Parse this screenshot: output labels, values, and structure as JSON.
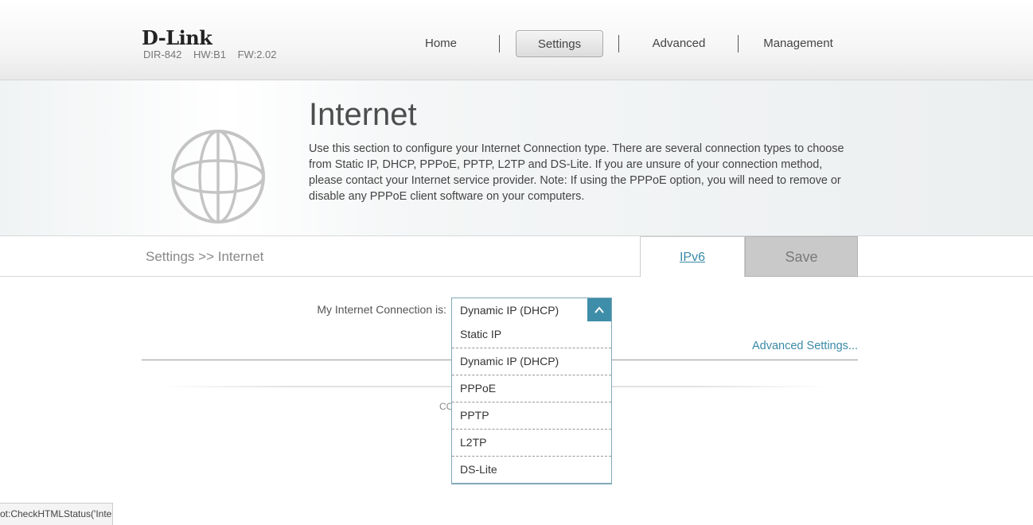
{
  "header": {
    "logo": "D-Link",
    "model": "DIR-842",
    "hw": "HW:B1",
    "fw": "FW:2.02"
  },
  "nav": {
    "items": [
      {
        "label": "Home",
        "active": false
      },
      {
        "label": "Settings",
        "active": true
      },
      {
        "label": "Advanced",
        "active": false
      },
      {
        "label": "Management",
        "active": false
      }
    ]
  },
  "banner": {
    "icon": "globe-icon",
    "title": "Internet",
    "description": "Use this section to configure your Internet Connection type. There are several connection types to choose from Static IP, DHCP, PPPoE, PPTP, L2TP and DS-Lite. If you are unsure of your connection method, please contact your Internet service provider. Note: If using the PPPoE option, you will need to remove or disable any PPPoE client software on your computers."
  },
  "toolbar": {
    "breadcrumb": "Settings >> Internet",
    "ipv6_label": "IPv6",
    "save_label": "Save"
  },
  "form": {
    "connection_label": "My Internet Connection is:",
    "connection_value": "Dynamic IP (DHCP)",
    "options": [
      "Static IP",
      "Dynamic IP (DHCP)",
      "PPPoE",
      "PPTP",
      "L2TP",
      "DS-Lite"
    ],
    "advanced_link": "Advanced Settings..."
  },
  "footer": {
    "copyright_partial": "CO"
  },
  "statusbar": {
    "text": "ot:CheckHTMLStatus('Inte"
  },
  "colors": {
    "accent": "#3f8ea9",
    "link": "#3a8aa6",
    "save_bg": "#c9c9c9"
  }
}
